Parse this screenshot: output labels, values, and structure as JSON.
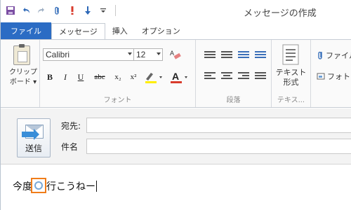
{
  "window": {
    "title": "メッセージの作成"
  },
  "qat": [
    "save-icon",
    "undo-icon",
    "redo-icon",
    "attach-icon",
    "importance-high-icon",
    "importance-low-icon",
    "customize-icon"
  ],
  "tabs": [
    {
      "label": "ファイル"
    },
    {
      "label": "メッセージ"
    },
    {
      "label": "挿入"
    },
    {
      "label": "オプション"
    }
  ],
  "ribbon": {
    "clipboard": {
      "label": "クリップ\nボード",
      "menu": "▾"
    },
    "font": {
      "name": "Calibri",
      "size": "12",
      "group_label": "フォント",
      "bold": "B",
      "italic": "I",
      "underline": "U",
      "strike": "abc",
      "subscript": "x₂",
      "superscript": "x²"
    },
    "paragraph": {
      "group_label": "段落"
    },
    "text": {
      "button_label": "テキスト\n形式",
      "group_label": "テキス..."
    },
    "insert": {
      "attach_label": "ファイル",
      "photo_label": "フォトア"
    }
  },
  "header": {
    "send_label": "送信",
    "to_label": "宛先:",
    "to_value": "",
    "subject_label": "件名",
    "subject_value": ""
  },
  "body": {
    "text_before": "今度",
    "text_after": "行こうねー"
  },
  "colors": {
    "file_tab": "#2b6cc4",
    "highlight_marker": "#ff8c1a",
    "accent": "#3a8ed8"
  }
}
